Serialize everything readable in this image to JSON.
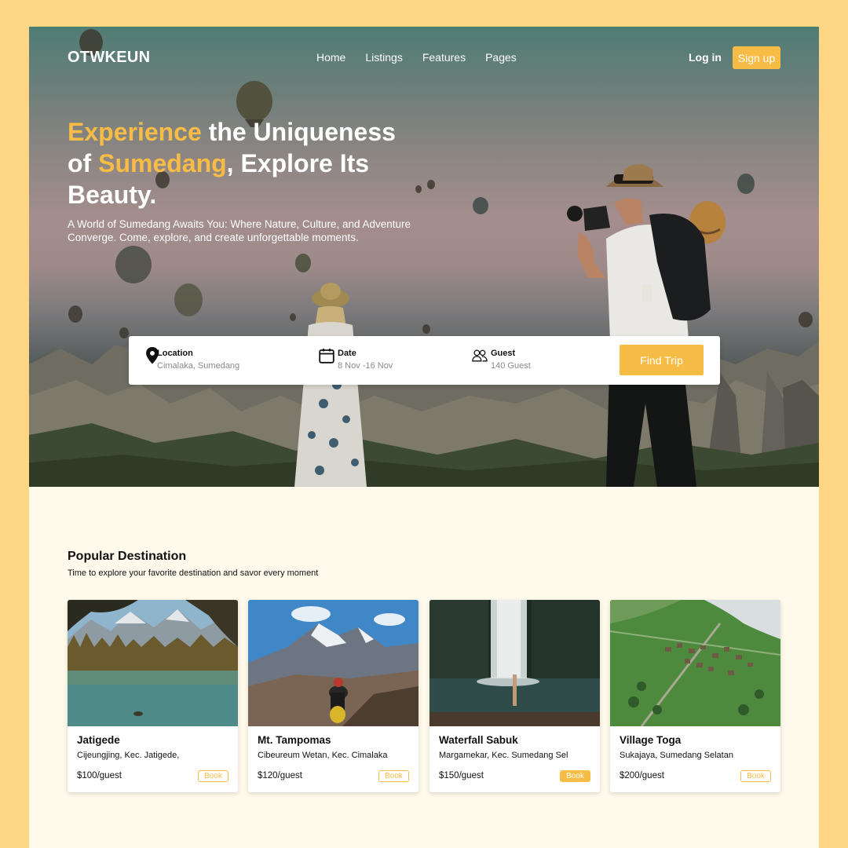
{
  "brand": {
    "logo": "OTWKEUN",
    "accent": "#F7BC46",
    "page_bg": "#FFD684",
    "content_bg": "#FFFAEB"
  },
  "nav": {
    "items": [
      {
        "label": "Home"
      },
      {
        "label": "Listings"
      },
      {
        "label": "Features"
      },
      {
        "label": "Pages"
      }
    ],
    "login_label": "Log in",
    "signup_label": "Sign up"
  },
  "hero": {
    "headline_parts": [
      "Experience",
      " the Uniqueness of ",
      "Sumedang",
      ", Explore Its Beauty."
    ],
    "subtitle": "A World of Sumedang Awaits You: Where Nature, Culture, and Adventure Converge. Come, explore, and create unforgettable moments."
  },
  "search": {
    "location": {
      "label": "Location",
      "value": "Cimalaka, Sumedang",
      "icon": "map-pin-icon"
    },
    "date": {
      "label": "Date",
      "value": "8 Nov -16 Nov",
      "icon": "calendar-icon"
    },
    "guest": {
      "label": "Guest",
      "value": "140 Guest",
      "icon": "users-icon"
    },
    "button_label": "Find Trip"
  },
  "popular": {
    "title": "Popular Destination",
    "subtitle": "Time to explore your favorite destination and savor every moment",
    "cards": [
      {
        "name": "Jatigede",
        "address": "Cijeungjing, Kec. Jatigede,",
        "price": "$100/guest",
        "book_label": "Book",
        "book_style": "outline"
      },
      {
        "name": "Mt. Tampomas",
        "address": "Cibeureum Wetan, Kec. Cimalaka",
        "price": "$120/guest",
        "book_label": "Book",
        "book_style": "outline"
      },
      {
        "name": "Waterfall Sabuk",
        "address": "Margamekar, Kec. Sumedang Sel",
        "price": "$150/guest",
        "book_label": "Book",
        "book_style": "filled"
      },
      {
        "name": "Village Toga",
        "address": "Sukajaya, Sumedang Selatan",
        "price": "$200/guest",
        "book_label": "Book",
        "book_style": "outline"
      }
    ]
  }
}
